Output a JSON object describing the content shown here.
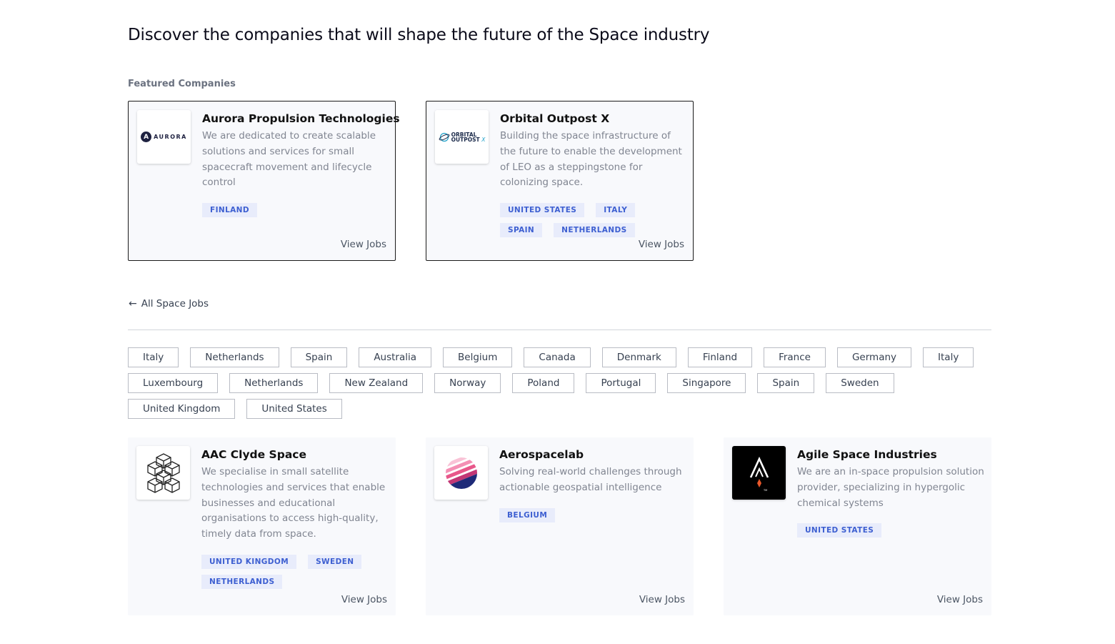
{
  "page": {
    "headline": "Discover the companies that will shape the future of the Space industry",
    "featured_label": "Featured Companies",
    "back_label": "All Space Jobs",
    "view_jobs_label": "View Jobs"
  },
  "featured": [
    {
      "name": "Aurora Propulsion Technologies",
      "description": "We are dedicated to create scalable solutions and services for small spacecraft movement and lifecycle control",
      "tags": [
        "FINLAND"
      ],
      "logo_text": "AURORA",
      "logo_icon": "aurora-logo-icon"
    },
    {
      "name": "Orbital Outpost X",
      "description": "Building the space infrastructure of the future to enable the development of LEO as a steppingstone for colonizing space.",
      "tags": [
        "UNITED STATES",
        "ITALY",
        "SPAIN",
        "NETHERLANDS"
      ],
      "logo_text": "ORBITAL OUTPOST X",
      "logo_icon": "orbital-outpost-logo-icon"
    }
  ],
  "filters": [
    "Italy",
    "Netherlands",
    "Spain",
    "Australia",
    "Belgium",
    "Canada",
    "Denmark",
    "Finland",
    "France",
    "Germany",
    "Italy",
    "Luxembourg",
    "Netherlands",
    "New Zealand",
    "Norway",
    "Poland",
    "Portugal",
    "Singapore",
    "Spain",
    "Sweden",
    "United Kingdom",
    "United States"
  ],
  "companies": [
    {
      "name": "AAC Clyde Space",
      "description": "We specialise in small satellite technologies and services that enable businesses and educational organisations to access high-quality, timely data from space.",
      "tags": [
        "UNITED KINGDOM",
        "SWEDEN",
        "NETHERLANDS"
      ],
      "logo_icon": "aac-clyde-cubes-logo-icon"
    },
    {
      "name": "Aerospacelab",
      "description": "Solving real-world challenges through actionable geospatial intelligence",
      "tags": [
        "BELGIUM"
      ],
      "logo_icon": "aerospacelab-sphere-logo-icon"
    },
    {
      "name": "Agile Space Industries",
      "description": "We are an in-space propulsion solution provider, specializing in hypergolic chemical systems",
      "tags": [
        "UNITED STATES"
      ],
      "logo_icon": "agile-space-rocket-logo-icon"
    }
  ],
  "colors": {
    "tag_bg": "#e8ecfb",
    "tag_text": "#3d5fd1",
    "card_bg": "#f8f9fc",
    "aerospacelab_gradient": [
      "#f7a8c4",
      "#e0336e",
      "#1e2a78"
    ],
    "agile_accent": "#e8572a"
  }
}
